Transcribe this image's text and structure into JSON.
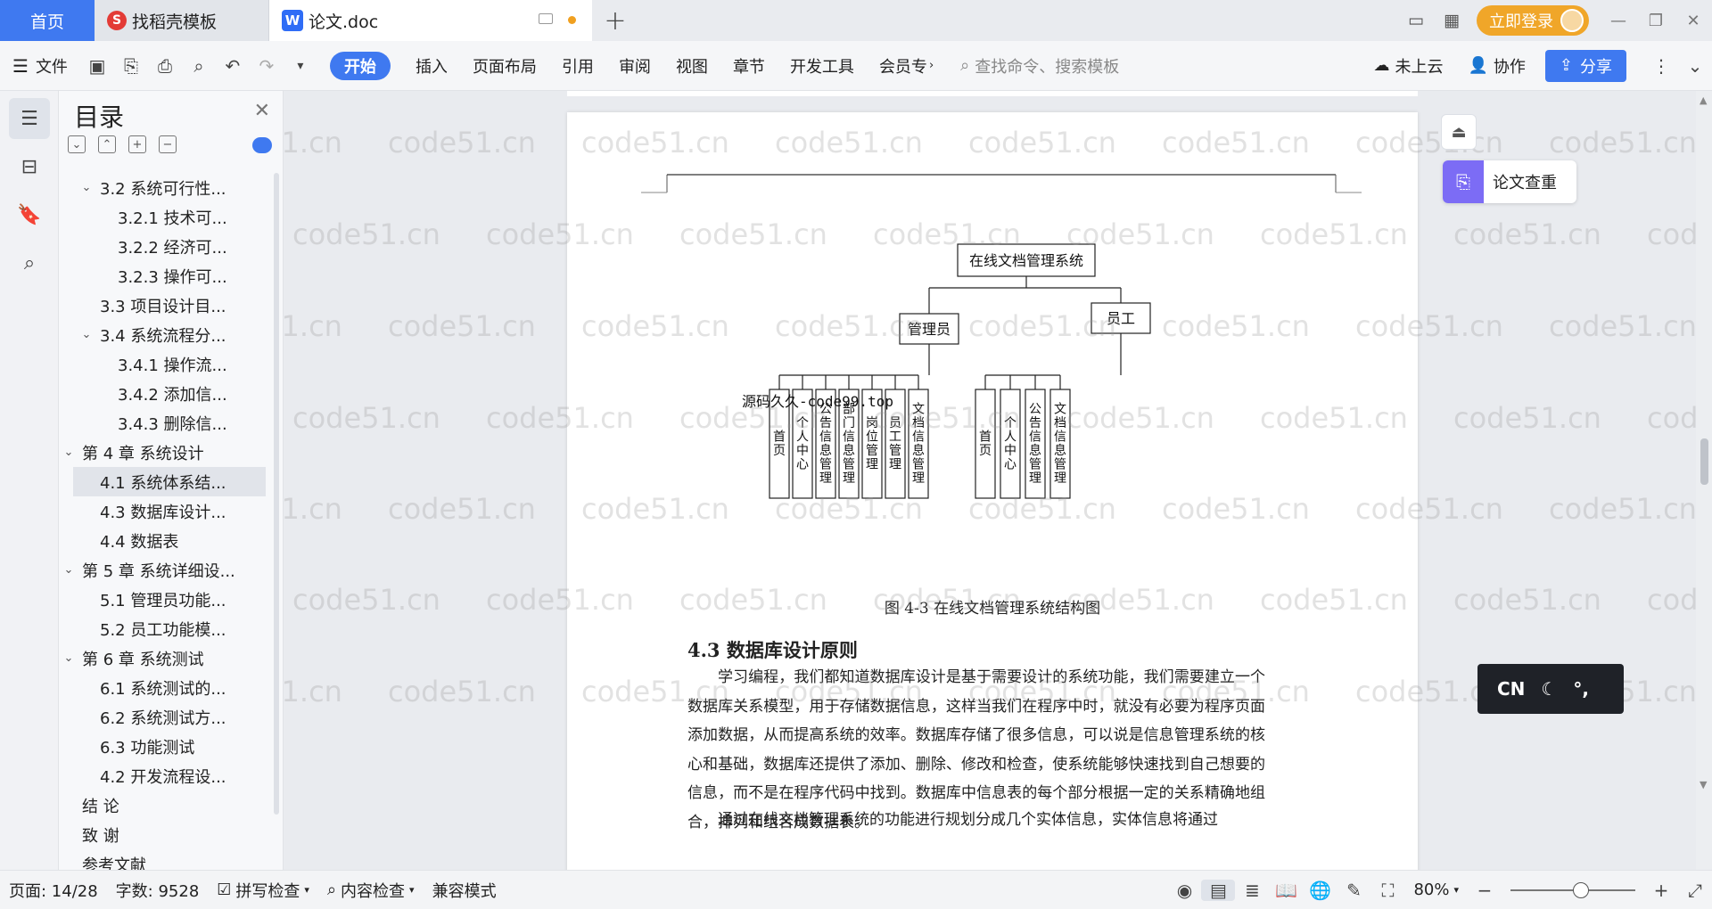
{
  "titlebar": {
    "home_tab": "首页",
    "templates_tab": "找稻壳模板",
    "doc_tab": "论文.doc",
    "login_button": "立即登录"
  },
  "ribbon": {
    "file_menu": "文件",
    "tabs": [
      "开始",
      "插入",
      "页面布局",
      "引用",
      "审阅",
      "视图",
      "章节",
      "开发工具",
      "会员专"
    ],
    "search_placeholder": "查找命令、搜索模板",
    "cloud": "未上云",
    "collab": "协作",
    "share": "分享"
  },
  "toc": {
    "title": "目录",
    "items": [
      {
        "label": "3.2 系统可行性...",
        "level": 2,
        "arrow": "down"
      },
      {
        "label": "3.2.1 技术可...",
        "level": 3
      },
      {
        "label": "3.2.2 经济可...",
        "level": 3
      },
      {
        "label": "3.2.3 操作可...",
        "level": 3
      },
      {
        "label": "3.3  项目设计目...",
        "level": 2
      },
      {
        "label": "3.4 系统流程分...",
        "level": 2,
        "arrow": "down"
      },
      {
        "label": "3.4.1 操作流...",
        "level": 3
      },
      {
        "label": "3.4.2 添加信...",
        "level": 3
      },
      {
        "label": "3.4.3 删除信...",
        "level": 3
      },
      {
        "label": "第 4 章  系统设计",
        "level": 1,
        "arrow": "down"
      },
      {
        "label": "4.1  系统体系结...",
        "level": 2,
        "selected": true
      },
      {
        "label": "4.3  数据库设计...",
        "level": 2
      },
      {
        "label": "4.4  数据表",
        "level": 2
      },
      {
        "label": "第 5 章  系统详细设...",
        "level": 1,
        "arrow": "down"
      },
      {
        "label": "5.1 管理员功能...",
        "level": 2
      },
      {
        "label": "5.2 员工功能模...",
        "level": 2
      },
      {
        "label": "第 6 章    系统测试",
        "level": 1,
        "arrow": "down"
      },
      {
        "label": "6.1 系统测试的...",
        "level": 2
      },
      {
        "label": "6.2 系统测试方...",
        "level": 2
      },
      {
        "label": "6.3 功能测试",
        "level": 2
      },
      {
        "label": "4.2 开发流程设...",
        "level": 2
      },
      {
        "label": "结    论",
        "level": 1
      },
      {
        "label": "致    谢",
        "level": 1
      },
      {
        "label": "参考文献",
        "level": 1
      }
    ]
  },
  "diagram": {
    "root": "在线文档管理系统",
    "admin": "管理员",
    "staff": "员工",
    "admin_children": [
      "首页",
      "个人中心",
      "公告信息管理",
      "部门信息管理",
      "岗位管理",
      "员工管理",
      "文档信息管理"
    ],
    "staff_children": [
      "首页",
      "个人中心",
      "公告信息管理",
      "文档信息管理"
    ],
    "overlay_text": "源码久久-code99.top"
  },
  "document": {
    "caption": "图 4-3  在线文档管理系统结构图",
    "heading": "4.3  数据库设计原则",
    "paragraph1": "学习编程，我们都知道数据库设计是基于需要设计的系统功能，我们需要建立一个数据库关系模型，用于存储数据信息，这样当我们在程序中时，就没有必要为程序页面添加数据，从而提高系统的效率。数据库存储了很多信息，可以说是信息管理系统的核心和基础，数据库还提供了添加、删除、修改和检查，使系统能够快速找到自己想要的信息，而不是在程序代码中找到。数据库中信息表的每个部分根据一定的关系精确地组合，排列和组合成数据表。",
    "paragraph2": "通过在线文档管理系统的功能进行规划分成几个实体信息，实体信息将通过"
  },
  "side": {
    "check_label": "论文查重",
    "ime_cn": "CN"
  },
  "status": {
    "page": "页面: 14/28",
    "words": "字数: 9528",
    "spell": "拼写检查",
    "content": "内容检查",
    "compat": "兼容模式",
    "zoom": "80%"
  },
  "watermark": "code51.cn"
}
